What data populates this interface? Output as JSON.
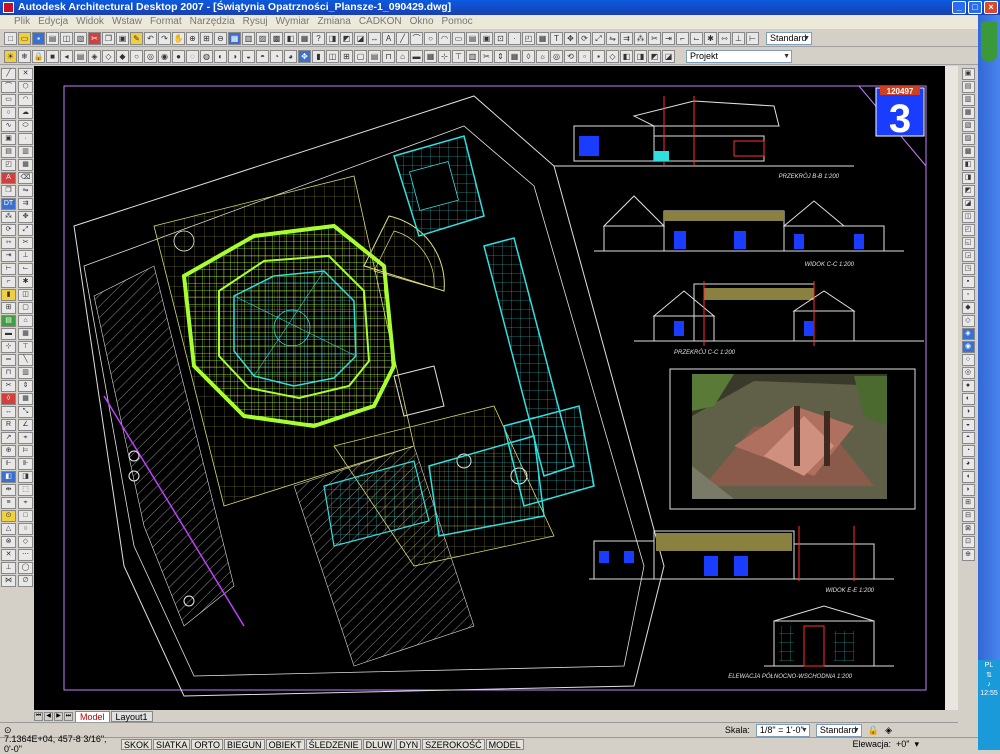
{
  "window": {
    "title": "Autodesk Architectural Desktop 2007 - [Świątynia Opatrzności_Plansze-1_090429.dwg]"
  },
  "menu": [
    "Plik",
    "Edycja",
    "Widok",
    "Wstaw",
    "Format",
    "Narzędzia",
    "Rysuj",
    "Wymiar",
    "Zmiana",
    "CADKON",
    "Okno",
    "Pomoc"
  ],
  "toolbar": {
    "style_combo": "Standard",
    "project_combo": "Projekt"
  },
  "sheet": {
    "number": "3",
    "code": "120497"
  },
  "labels": {
    "section_bb": "PRZEKRÓJ B-B  1:200",
    "view_cc": "WIDOK C-C  1:200",
    "section_cc": "PRZEKRÓJ C-C  1:200",
    "view_ee": "WIDOK E-E  1:200",
    "elevation_ne": "ELEWACJA PÓŁNOCNO-WSCHODNIA  1:200"
  },
  "tabs": {
    "model": "Model",
    "layout1": "Layout1"
  },
  "cmd": {
    "scale_label": "Skala:",
    "scale_value": "1/8\" = 1'-0\"",
    "style": "Standard",
    "elev_label": "Elewacja:",
    "elev_value": "+0\""
  },
  "status": {
    "coords": "7.1364E+04,  457-8 3/16\", 0'-0\"",
    "toggles": [
      "SKOK",
      "SIATKA",
      "ORTO",
      "BIEGUN",
      "OBIEKT",
      "ŚLEDZENIE",
      "DLUW",
      "DYN",
      "SZEROKOŚĆ",
      "MODEL"
    ]
  },
  "tray": {
    "lang": "PL",
    "clock": "12:55"
  },
  "colors": {
    "titlebar": "#0a5be0",
    "canvas": "#000000",
    "plan_green": "#a8ff30",
    "plan_cyan": "#30e0e0",
    "sheet_blue": "#1a3cff"
  }
}
